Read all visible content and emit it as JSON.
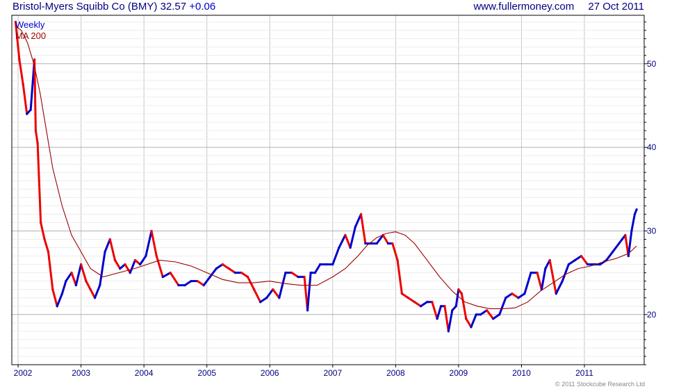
{
  "header": {
    "title": "Bristol-Myers Squibb Co (BMY)",
    "price": "32.57",
    "change": "+0.06",
    "site": "www.fullermoney.com",
    "date": "27 Oct 2011"
  },
  "footer": {
    "copyright": "© 2011 Stockcube Research Ltd"
  },
  "colors": {
    "up": "#0000cc",
    "down": "#ee0000",
    "ma": "#990000",
    "grid": "#c8c8c8",
    "frame": "#000000"
  },
  "chart_data": {
    "type": "line",
    "title": "Bristol-Myers Squibb Co (BMY)",
    "legend": [
      "Weekly",
      "MA 200"
    ],
    "legend_position": "top-left",
    "xlabel": "",
    "ylabel": "",
    "x_ticks": [
      "2002",
      "2003",
      "2004",
      "2005",
      "2006",
      "2007",
      "2008",
      "2009",
      "2010",
      "2011"
    ],
    "y_ticks": [
      20,
      30,
      40,
      50
    ],
    "ylim": [
      14.0,
      55.8
    ],
    "xlim": [
      2001.9,
      2011.95
    ],
    "grid": true,
    "series": [
      {
        "name": "Weekly",
        "x": [
          2001.96,
          2002.02,
          2002.08,
          2002.14,
          2002.2,
          2002.26,
          2002.28,
          2002.31,
          2002.36,
          2002.42,
          2002.48,
          2002.55,
          2002.62,
          2002.7,
          2002.76,
          2002.85,
          2002.92,
          2003.0,
          2003.08,
          2003.15,
          2003.22,
          2003.3,
          2003.38,
          2003.46,
          2003.54,
          2003.62,
          2003.7,
          2003.78,
          2003.86,
          2003.94,
          2004.03,
          2004.12,
          2004.2,
          2004.3,
          2004.42,
          2004.55,
          2004.65,
          2004.75,
          2004.85,
          2004.95,
          2005.05,
          2005.15,
          2005.25,
          2005.35,
          2005.45,
          2005.55,
          2005.65,
          2005.75,
          2005.85,
          2005.95,
          2006.05,
          2006.15,
          2006.25,
          2006.35,
          2006.45,
          2006.55,
          2006.6,
          2006.65,
          2006.72,
          2006.8,
          2006.9,
          2007.0,
          2007.1,
          2007.2,
          2007.28,
          2007.36,
          2007.42,
          2007.45,
          2007.52,
          2007.6,
          2007.7,
          2007.8,
          2007.88,
          2007.95,
          2008.03,
          2008.1,
          2008.2,
          2008.3,
          2008.4,
          2008.5,
          2008.58,
          2008.66,
          2008.72,
          2008.78,
          2008.84,
          2008.9,
          2008.96,
          2009.0,
          2009.05,
          2009.12,
          2009.2,
          2009.28,
          2009.35,
          2009.45,
          2009.55,
          2009.65,
          2009.75,
          2009.85,
          2009.95,
          2010.05,
          2010.15,
          2010.25,
          2010.32,
          2010.38,
          2010.45,
          2010.55,
          2010.65,
          2010.75,
          2010.85,
          2010.95,
          2011.05,
          2011.15,
          2011.25,
          2011.35,
          2011.45,
          2011.55,
          2011.6,
          2011.65,
          2011.7,
          2011.75,
          2011.8,
          2011.83
        ],
        "values": [
          55.0,
          50.5,
          47.5,
          44.0,
          44.5,
          50.5,
          42.0,
          40.5,
          31.0,
          29.0,
          27.5,
          23.0,
          21.0,
          22.5,
          24.0,
          25.0,
          23.5,
          26.0,
          24.0,
          23.0,
          22.0,
          23.5,
          27.5,
          29.0,
          26.5,
          25.5,
          26.0,
          25.0,
          26.5,
          26.0,
          27.0,
          30.0,
          27.0,
          24.5,
          25.0,
          23.5,
          23.5,
          24.0,
          24.0,
          23.5,
          24.5,
          25.5,
          26.0,
          25.5,
          25.0,
          25.0,
          24.5,
          23.0,
          21.5,
          22.0,
          23.0,
          22.0,
          25.0,
          25.0,
          24.5,
          24.5,
          20.5,
          25.0,
          25.0,
          26.0,
          26.0,
          26.0,
          28.0,
          29.5,
          28.0,
          30.5,
          31.5,
          32.0,
          28.5,
          28.5,
          28.5,
          29.5,
          28.5,
          28.5,
          26.5,
          22.5,
          22.0,
          21.5,
          21.0,
          21.5,
          21.5,
          19.5,
          21.0,
          21.0,
          18.0,
          20.5,
          21.0,
          23.0,
          22.5,
          19.5,
          18.5,
          20.0,
          20.0,
          20.5,
          19.5,
          20.0,
          22.0,
          22.5,
          22.0,
          22.5,
          25.0,
          25.0,
          23.0,
          25.5,
          26.5,
          22.5,
          24.0,
          26.0,
          26.5,
          27.0,
          26.0,
          26.0,
          26.0,
          26.5,
          27.5,
          28.5,
          29.0,
          29.5,
          27.0,
          30.0,
          32.0,
          32.57
        ]
      },
      {
        "name": "MA 200",
        "x": [
          2001.96,
          2002.05,
          2002.15,
          2002.25,
          2002.35,
          2002.45,
          2002.55,
          2002.7,
          2002.85,
          2003.0,
          2003.15,
          2003.35,
          2003.6,
          2003.85,
          2004.05,
          2004.25,
          2004.5,
          2004.75,
          2005.0,
          2005.25,
          2005.5,
          2005.75,
          2006.0,
          2006.25,
          2006.5,
          2006.75,
          2007.0,
          2007.2,
          2007.4,
          2007.55,
          2007.7,
          2007.85,
          2008.0,
          2008.15,
          2008.3,
          2008.5,
          2008.7,
          2008.9,
          2009.1,
          2009.3,
          2009.5,
          2009.7,
          2009.9,
          2010.1,
          2010.3,
          2010.5,
          2010.7,
          2010.9,
          2011.1,
          2011.3,
          2011.5,
          2011.7,
          2011.83
        ],
        "values": [
          54.5,
          54.0,
          52.5,
          50.0,
          46.5,
          42.0,
          37.5,
          33.0,
          29.5,
          27.5,
          25.5,
          24.5,
          25.0,
          25.5,
          26.0,
          26.5,
          26.3,
          25.8,
          25.0,
          24.2,
          23.8,
          23.8,
          24.0,
          23.7,
          23.5,
          23.5,
          24.5,
          25.5,
          27.0,
          28.3,
          29.2,
          29.7,
          29.9,
          29.5,
          28.5,
          26.5,
          24.5,
          22.8,
          21.5,
          21.0,
          20.7,
          20.7,
          20.8,
          21.5,
          22.8,
          23.8,
          24.8,
          25.5,
          25.8,
          26.3,
          26.7,
          27.3,
          28.2
        ]
      }
    ]
  }
}
